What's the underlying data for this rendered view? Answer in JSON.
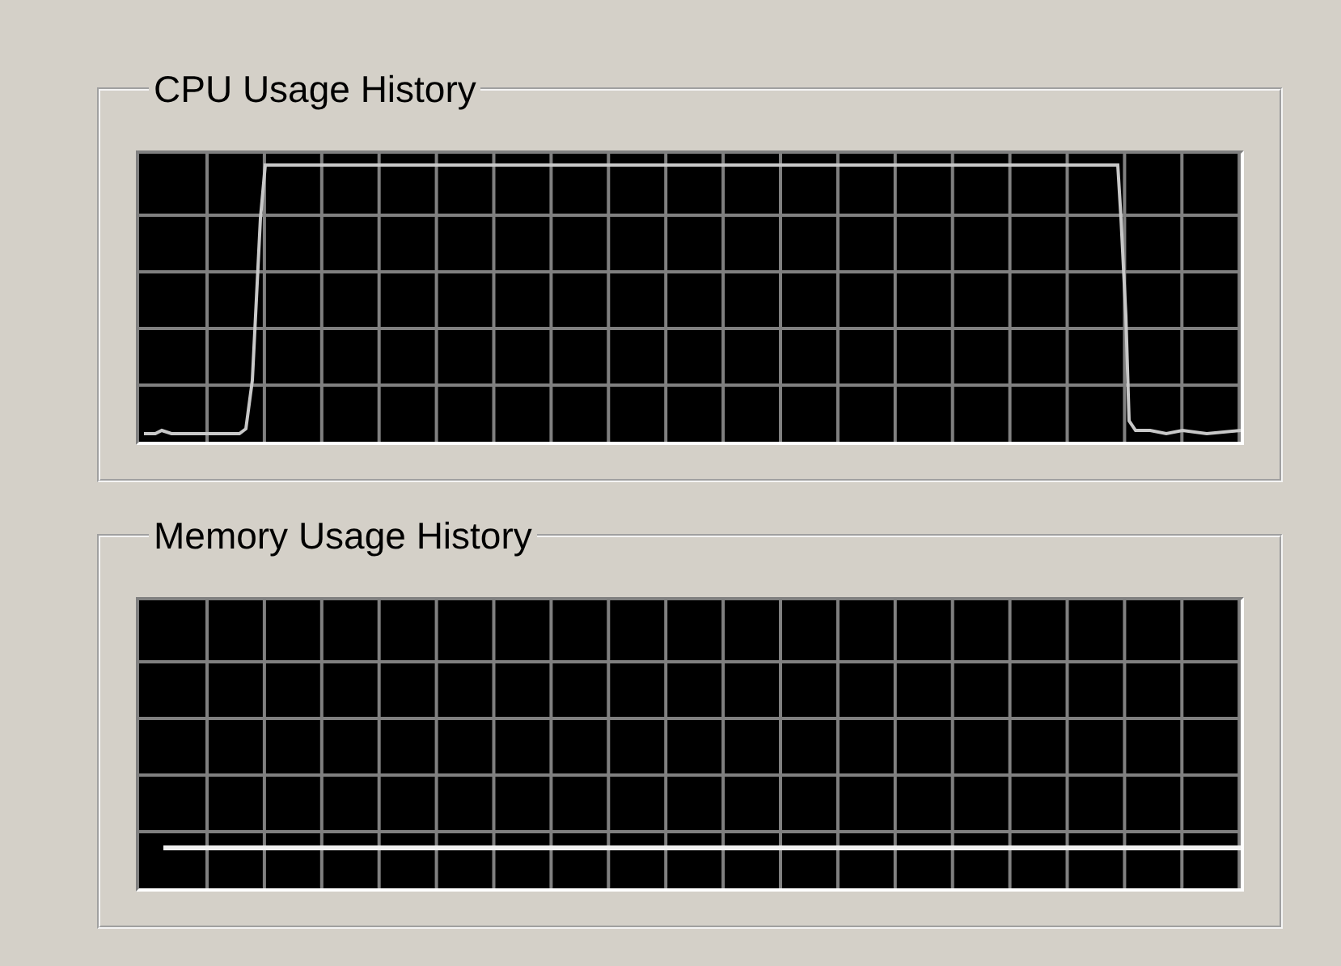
{
  "cpu_usage_history": {
    "title": "CPU Usage History",
    "kind": "cpu"
  },
  "memory_usage_history": {
    "title": "Memory Usage History",
    "kind": "memory"
  }
}
